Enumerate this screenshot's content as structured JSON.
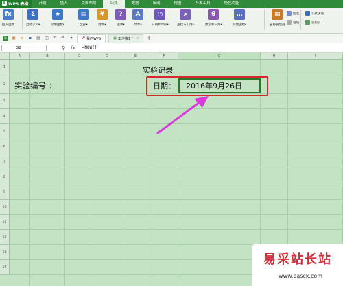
{
  "app": {
    "name": "WPS 表格"
  },
  "menu_tabs": [
    "开始",
    "插入",
    "页面布局",
    "公式",
    "数据",
    "审阅",
    "视图",
    "开发工具",
    "特色功能"
  ],
  "active_menu_tab": "公式",
  "ribbon": {
    "buttons": [
      {
        "label": "插入函数",
        "icon": "fx-icon",
        "glyph": "fx",
        "color": "#4a7cc9"
      },
      {
        "label": "自动求和▾",
        "icon": "sigma-icon",
        "glyph": "Σ",
        "color": "#3b6fc4"
      },
      {
        "label": "常用函数▾",
        "icon": "star-function-icon",
        "glyph": "★",
        "color": "#3d79c6"
      },
      {
        "label": "全部▾",
        "icon": "all-functions-icon",
        "glyph": "▤",
        "color": "#3d79c6"
      },
      {
        "label": "财务▾",
        "icon": "finance-icon",
        "glyph": "¥",
        "color": "#d39a2b"
      },
      {
        "label": "逻辑▾",
        "icon": "logic-icon",
        "glyph": "?",
        "color": "#7c5bb8"
      },
      {
        "label": "文本▾",
        "icon": "text-icon",
        "glyph": "A",
        "color": "#5b7ac2"
      },
      {
        "label": "日期和时间▾",
        "icon": "clock-icon",
        "glyph": "◷",
        "color": "#6d58b8"
      },
      {
        "label": "查找与引用▾",
        "icon": "lookup-icon",
        "glyph": "⌕",
        "color": "#7a63b5"
      },
      {
        "label": "数学和三角▾",
        "icon": "math-icon",
        "glyph": "θ",
        "color": "#8a58b3"
      },
      {
        "label": "其他函数▾",
        "icon": "more-functions-icon",
        "glyph": "…",
        "color": "#5a6fc0"
      },
      {
        "label": "名称管理器",
        "icon": "name-manager-icon",
        "glyph": "▦",
        "color": "#c77a2a"
      }
    ],
    "small": [
      {
        "label": "指定",
        "icon": "specify-icon"
      },
      {
        "label": "粘贴",
        "icon": "paste-name-icon"
      },
      {
        "label": "公式求值",
        "icon": "formula-eval-icon"
      },
      {
        "label": "追踪引",
        "icon": "trace-icon"
      }
    ]
  },
  "doc_tabs": [
    {
      "label": "我的WPS",
      "active": false
    },
    {
      "label": "工作簿1 *",
      "active": true
    }
  ],
  "formula_bar": {
    "name_box": "G2",
    "fx": "fx",
    "formula": "=NOW()"
  },
  "columns": [
    "A",
    "B",
    "C",
    "D",
    "E",
    "F",
    "G",
    "H",
    "I"
  ],
  "selected_column": "G",
  "rows": [
    "1",
    "2",
    "3",
    "4",
    "5",
    "6",
    "7",
    "8",
    "9",
    "10",
    "11",
    "12",
    "13",
    "14"
  ],
  "cells": {
    "title": "实验记录",
    "label": "实验编号 ：",
    "date_label": "日期：",
    "date_value": "2016年9月26日"
  },
  "watermark": {
    "title": "易采站长站",
    "url": "www.easck.com"
  },
  "colors": {
    "accent": "#2f8a3a",
    "highlight": "#d8282c",
    "arrow": "#d93ad9"
  }
}
